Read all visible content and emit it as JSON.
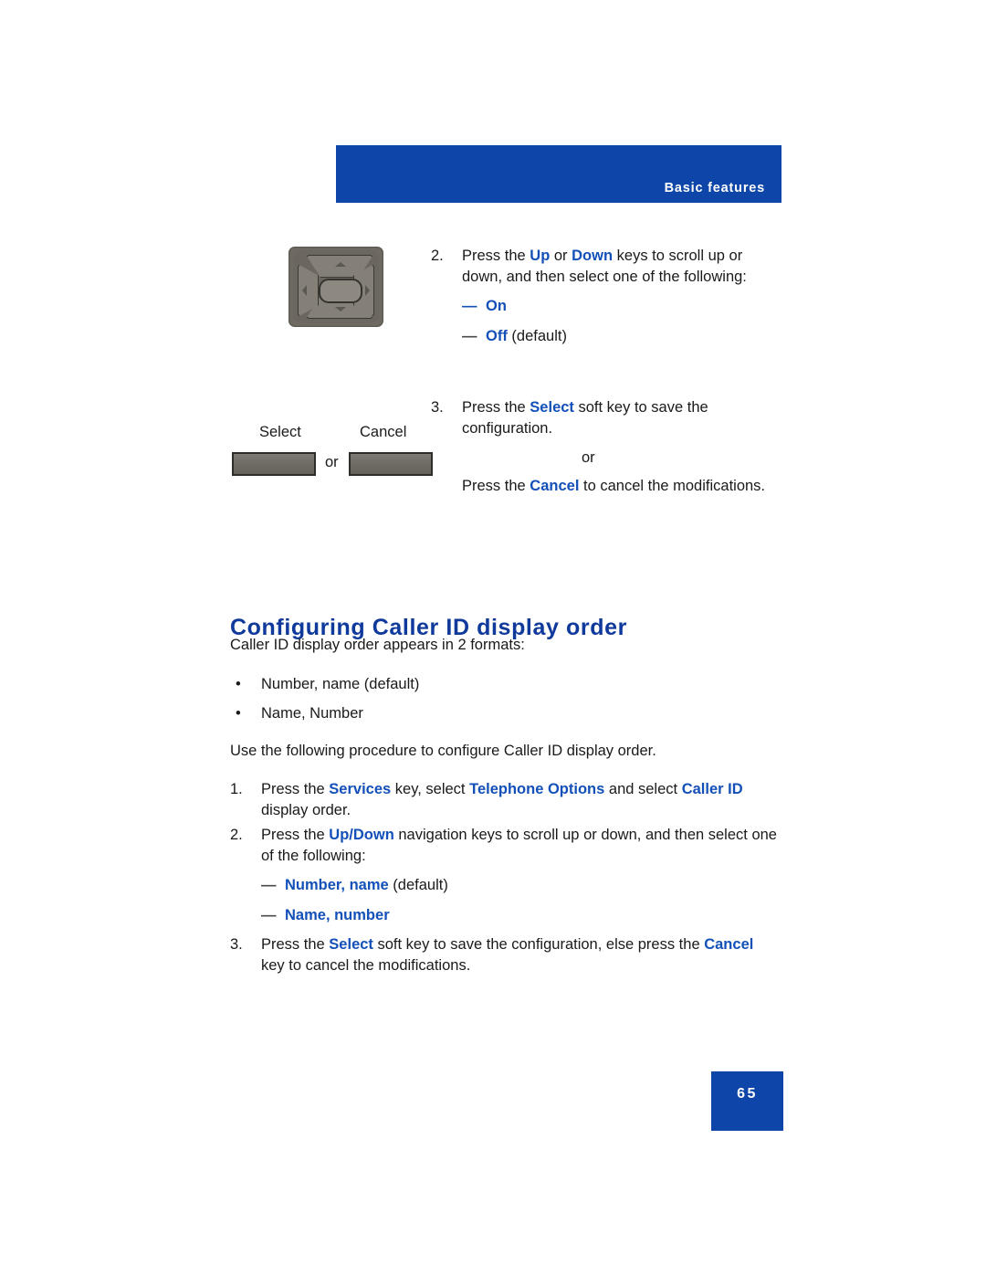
{
  "document": {
    "header": {
      "section_label": "Basic features",
      "bar_color": "#0d46a8"
    },
    "footer": {
      "page_number": "65",
      "box_color": "#0d46a8"
    },
    "colors": {
      "link_blue": "#1350b8",
      "heading_blue": "#10399c",
      "body_black": "#1a1a1a"
    },
    "top_procedure": {
      "step2": {
        "number": "2.",
        "text_before_up": "Press the ",
        "kw_up": "Up",
        "text_mid": " or ",
        "kw_down": "Down",
        "text_after": " keys to scroll up or down, and then select one of the following:",
        "options": [
          {
            "dash": "—",
            "dash_color": "blue",
            "label": "On",
            "suffix": ""
          },
          {
            "dash": "—",
            "dash_color": "gray",
            "label": "Off",
            "suffix": " (default)"
          }
        ]
      },
      "step3": {
        "number": "3.",
        "text_before": "Press the ",
        "kw_select": "Select",
        "text_after": " soft key to save the configuration.",
        "or_word": "or",
        "second_before": "Press the ",
        "kw_cancel": "Cancel",
        "second_after": " to cancel the modifications."
      },
      "softkeys": {
        "select_label": "Select",
        "cancel_label": "Cancel",
        "or_label": "or"
      },
      "nav_key_icon": "navigation-keys-icon"
    },
    "section": {
      "heading": "Configuring Caller ID display order",
      "intro": "Caller ID display order appears in 2 formats:",
      "formats": [
        {
          "bullet": "•",
          "text": "Number, name (default)"
        },
        {
          "bullet": "•",
          "text": "Name, Number"
        }
      ],
      "procedure_intro": "Use the following procedure to configure Caller ID display order.",
      "steps": [
        {
          "number": "1.",
          "segments": [
            {
              "text": "Press the ",
              "style": "plain"
            },
            {
              "text": "Services",
              "style": "blue"
            },
            {
              "text": " key, select ",
              "style": "plain"
            },
            {
              "text": "Telephone Options",
              "style": "blue"
            },
            {
              "text": " and select ",
              "style": "plain"
            },
            {
              "text": "Caller ID",
              "style": "blue"
            },
            {
              "text": " display order.",
              "style": "plain"
            }
          ]
        },
        {
          "number": "2.",
          "segments": [
            {
              "text": "Press the ",
              "style": "plain"
            },
            {
              "text": "Up/Down",
              "style": "blue"
            },
            {
              "text": " navigation keys to scroll up or down, and then select one of the following:",
              "style": "plain"
            }
          ],
          "options": [
            {
              "dash": "—",
              "dash_color": "gray",
              "label": "Number, name",
              "suffix": " (default)"
            },
            {
              "dash": "—",
              "dash_color": "gray",
              "label": "Name, number",
              "suffix": ""
            }
          ]
        },
        {
          "number": "3.",
          "segments": [
            {
              "text": "Press the ",
              "style": "plain"
            },
            {
              "text": "Select",
              "style": "blue"
            },
            {
              "text": " soft key to save the configuration, else press the ",
              "style": "plain"
            },
            {
              "text": "Cancel",
              "style": "blue"
            },
            {
              "text": " key to cancel the modifications.",
              "style": "plain"
            }
          ]
        }
      ]
    }
  }
}
